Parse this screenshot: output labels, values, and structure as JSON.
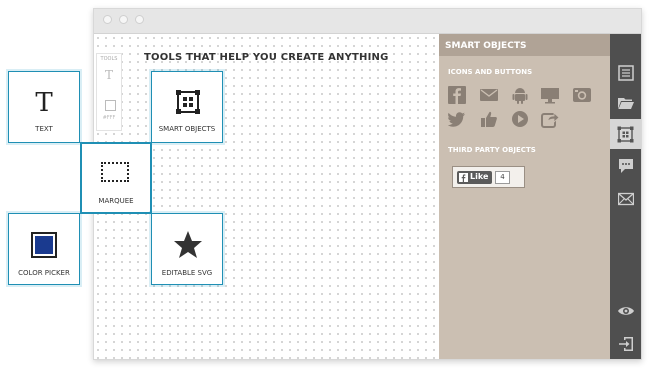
{
  "canvas": {
    "heading": "TOOLS THAT HELP YOU CREATE ANYTHING",
    "tools_bar": {
      "label": "TOOLS",
      "text_glyph": "T",
      "color_value": "#FFF"
    }
  },
  "tiles": {
    "text": {
      "glyph": "T",
      "label": "TEXT"
    },
    "smart_objects": {
      "label": "SMART OBJECTS"
    },
    "marquee": {
      "label": "MARQUEE"
    },
    "color_picker": {
      "label": "COLOR PICKER",
      "swatch_color": "#1a3a8f"
    },
    "editable_svg": {
      "label": "EDITABLE SVG"
    }
  },
  "panel": {
    "title": "SMART OBJECTS",
    "section_icons": "ICONS AND BUTTONS",
    "icons": [
      "facebook-icon",
      "mail-icon",
      "android-icon",
      "monitor-icon",
      "camera-icon",
      "twitter-icon",
      "thumbs-up-icon",
      "play-icon",
      "share-icon"
    ],
    "section_third_party": "THIRD PARTY OBJECTS",
    "like_button": {
      "label": "Like",
      "count": "4"
    }
  },
  "rail": {
    "icons": [
      "pages-icon",
      "folder-icon",
      "smart-objects-icon",
      "comments-icon",
      "envelope-icon",
      "preview-eye-icon",
      "exit-icon"
    ],
    "selected": "smart-objects-icon"
  },
  "colors": {
    "accent": "#1f8fb4",
    "panel_bg": "#cbbfb2",
    "rail_bg": "#4f4f4f"
  }
}
